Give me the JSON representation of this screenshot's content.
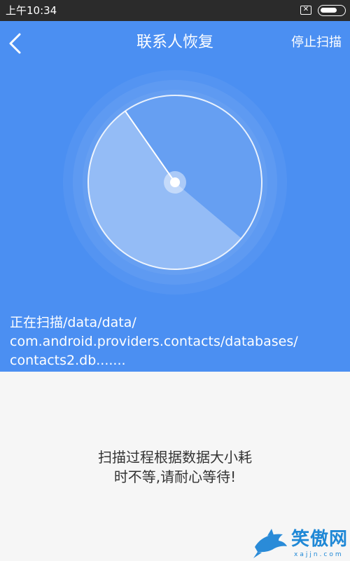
{
  "status_bar": {
    "time": "上午10:34",
    "icons": [
      "close-box-icon",
      "battery-icon"
    ],
    "battery_level": 0.75
  },
  "header": {
    "back_icon": "chevron-left-icon",
    "title": "联系人恢复",
    "stop_label": "停止扫描"
  },
  "radar": {
    "icon": "radar-scan-icon"
  },
  "scan": {
    "path_lines": [
      "正在扫描/data/data/",
      "com.android.providers.contacts/databases/",
      "contacts2.db......."
    ]
  },
  "hint": {
    "lines": [
      "扫描过程根据数据大小耗",
      "时不等,请耐心等待!"
    ]
  },
  "watermark": {
    "brand": "笑傲网",
    "domain": "xajjn.com",
    "logo_icon": "shark-logo-icon"
  },
  "colors": {
    "status_bar": "#2b2b2b",
    "header_blue": "#4b8ff2",
    "body_bg": "#f6f6f6",
    "hint_text": "#333333",
    "watermark_blue": "#1f88d6"
  }
}
